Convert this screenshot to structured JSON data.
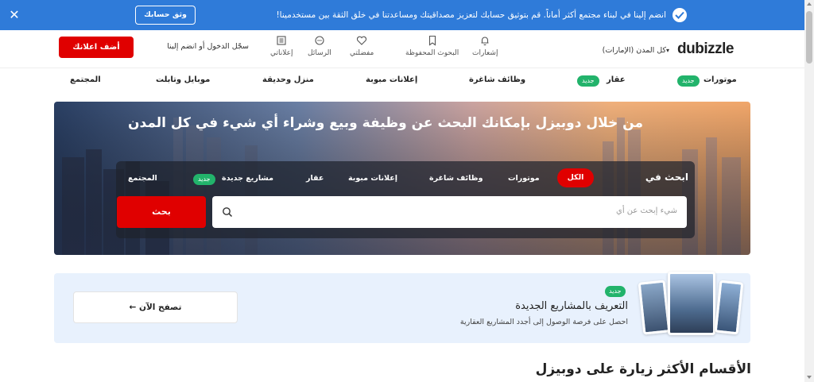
{
  "banner": {
    "message": "انضم إلينا في لبناء مجتمع أكثر أماناً. قم بتوثيق حسابك لتعزيز مصداقيتك ومساعدتنا في خلق الثقة بين مستخدمينا!",
    "verify_label": "وثق حسابك",
    "close_label": "✕"
  },
  "header": {
    "logo": "dubizzle",
    "location": "كل المدن (الإمارات)",
    "notifications": "إشعارات",
    "saved_searches": "البحوث المحفوظة",
    "favorites": "مفضلتي",
    "messages": "الرسائل",
    "my_ads": "إعلاناتي",
    "login": "سجّل الدخول أو انضم إلينا",
    "post_ad": "أضف اعلانك"
  },
  "nav": {
    "motors": "موتورات",
    "property": "عقار",
    "jobs": "وظائف شاغرة",
    "classifieds": "إعلانات مبوبة",
    "home_garden": "منزل وحديقة",
    "mobiles": "موبايل وتابلت",
    "community": "المجتمع",
    "new_badge": "جديد"
  },
  "hero": {
    "title": "من خلال دوبيزل بإمكانك البحث عن وظيفة وبيع وشراء أي شيء في كل المدن",
    "search_in": "ابحث في",
    "tabs": {
      "all": "الكل",
      "motors": "موتورات",
      "jobs": "وظائف شاغرة",
      "classifieds": "إعلانات مبوبة",
      "property": "عقار",
      "new_projects": "مشاريع جديدة",
      "community": "المجتمع",
      "new_badge": "جديد"
    },
    "placeholder": "شيء إبحث عن أي",
    "search_button": "بحث"
  },
  "promo": {
    "badge": "جديد",
    "title": "التعريف بالمشاريع الجديدة",
    "subtitle": "احصل على فرصة الوصول إلى أجدد المشاريع العقارية",
    "browse": "تصفح الآن"
  },
  "section": {
    "title": "الأقسام الأكثر زيارة على دوبيزل"
  },
  "colors": {
    "brand_red": "#e00000",
    "banner_blue": "#2f7bd9",
    "badge_green": "#22b36b",
    "promo_bg": "#e8f1fd"
  }
}
